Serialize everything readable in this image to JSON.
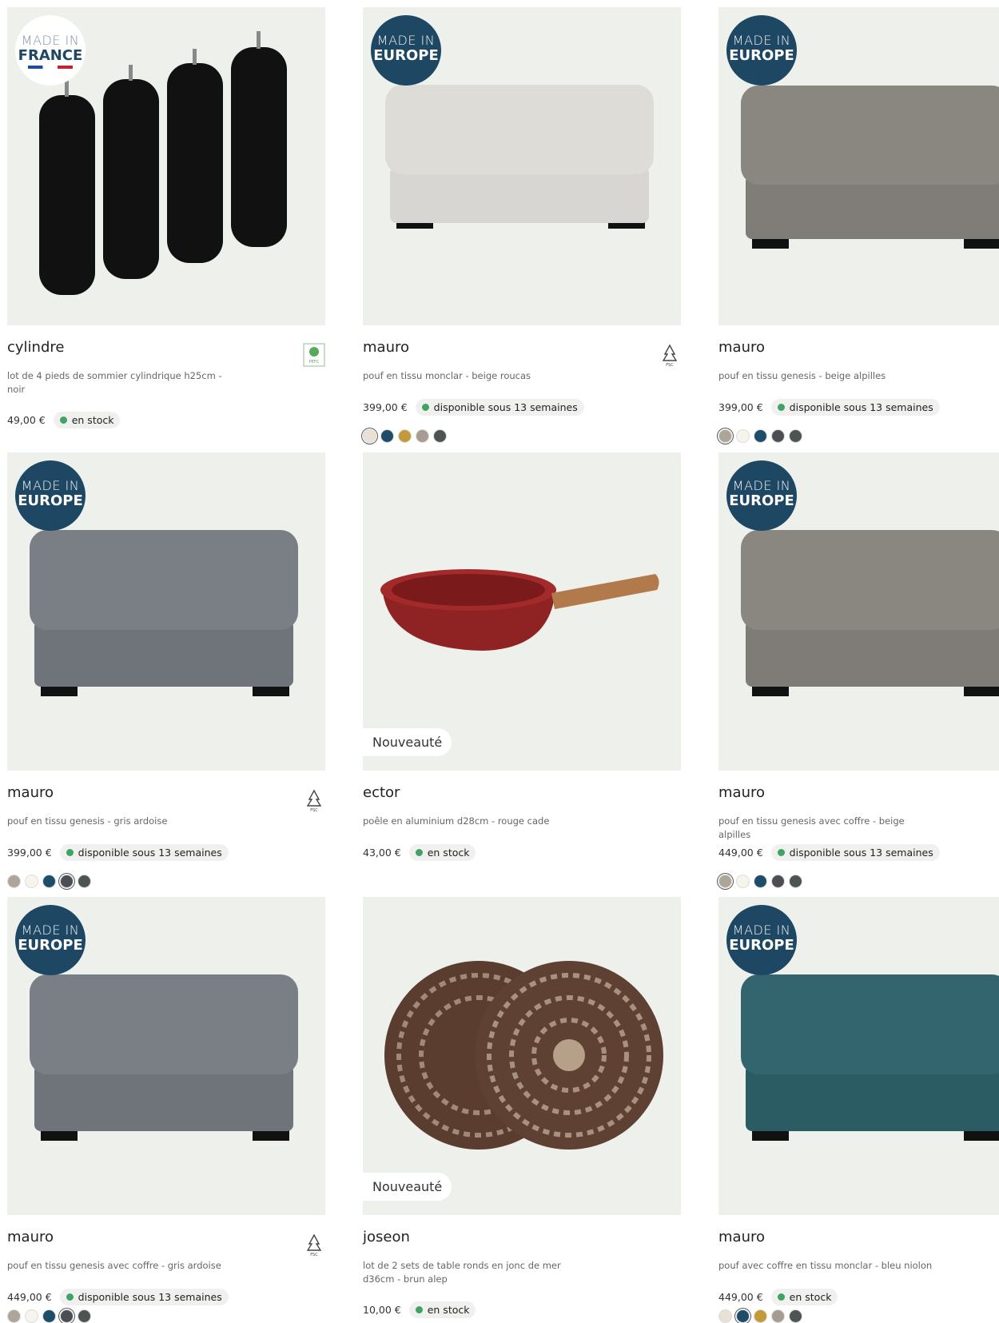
{
  "products": [
    {
      "title": "cylindre",
      "desc": "lot de 4 pieds de sommier cylindrique h25cm - noir",
      "price": "49,00 €",
      "stock": "en stock",
      "badge": {
        "line1": "MADE IN",
        "line2": "FRANCE"
      },
      "swatches": []
    },
    {
      "title": "mauro",
      "desc": "pouf en tissu monclar - beige roucas",
      "price": "399,00 €",
      "stock": "disponible sous 13 semaines",
      "badge": {
        "line1": "MADE IN",
        "line2": "EUROPE"
      },
      "swatches": [
        "#e9e1d6",
        "#1e4d69",
        "#c49a38",
        "#a89c92",
        "#4d5551"
      ]
    },
    {
      "title": "mauro",
      "desc": "pouf en tissu genesis - beige alpilles",
      "price": "399,00 €",
      "stock": "disponible sous 13 semaines",
      "badge": {
        "line1": "MADE IN",
        "line2": "EUROPE"
      },
      "swatches": [
        "#aca598",
        "#f6f4ec",
        "#1e4d69",
        "#4b4f53",
        "#4d5551"
      ]
    },
    {
      "title": "mauro",
      "desc": "pouf en tissu genesis - gris ardoise",
      "price": "399,00 €",
      "stock": "disponible sous 13 semaines",
      "badge": {
        "line1": "MADE IN",
        "line2": "EUROPE"
      },
      "swatches": [
        "#aca598",
        "#f6f4ec",
        "#1e4d69",
        "#4b4f53",
        "#4d5551"
      ]
    },
    {
      "title": "ector",
      "desc": "poêle en aluminium d28cm - rouge cade",
      "price": "43,00 €",
      "stock": "en stock",
      "tag": "Nouveauté",
      "swatches": []
    },
    {
      "title": "mauro",
      "desc": "pouf en tissu genesis avec coffre - beige alpilles",
      "price": "449,00 €",
      "stock": "disponible sous 13 semaines",
      "badge": {
        "line1": "MADE IN",
        "line2": "EUROPE"
      },
      "swatches": [
        "#aca598",
        "#f6f4ec",
        "#1e4d69",
        "#4b4f53",
        "#4d5551"
      ]
    },
    {
      "title": "mauro",
      "desc": "pouf en tissu genesis avec coffre - gris ardoise",
      "price": "449,00 €",
      "stock": "disponible sous 13 semaines",
      "badge": {
        "line1": "MADE IN",
        "line2": "EUROPE"
      },
      "swatches": [
        "#aca598",
        "#f6f4ec",
        "#1e4d69",
        "#4b4f53",
        "#4d5551"
      ]
    },
    {
      "title": "joseon",
      "desc": "lot de 2 sets de table ronds en jonc de mer d36cm - brun alep",
      "price": "10,00 €",
      "stock": "en stock",
      "tag": "Nouveauté",
      "swatches": []
    },
    {
      "title": "mauro",
      "desc": "pouf avec coffre en tissu monclar - bleu niolon",
      "price": "449,00 €",
      "stock": "en stock",
      "badge": {
        "line1": "MADE IN",
        "line2": "EUROPE"
      },
      "swatches": [
        "#e9e1d6",
        "#1e4d69",
        "#c49a38",
        "#a89c92",
        "#4d5551"
      ]
    }
  ],
  "colors": {
    "badge": "#1d4763",
    "stock_dot": "#3fa463",
    "image_bg": "#eef0ec"
  }
}
